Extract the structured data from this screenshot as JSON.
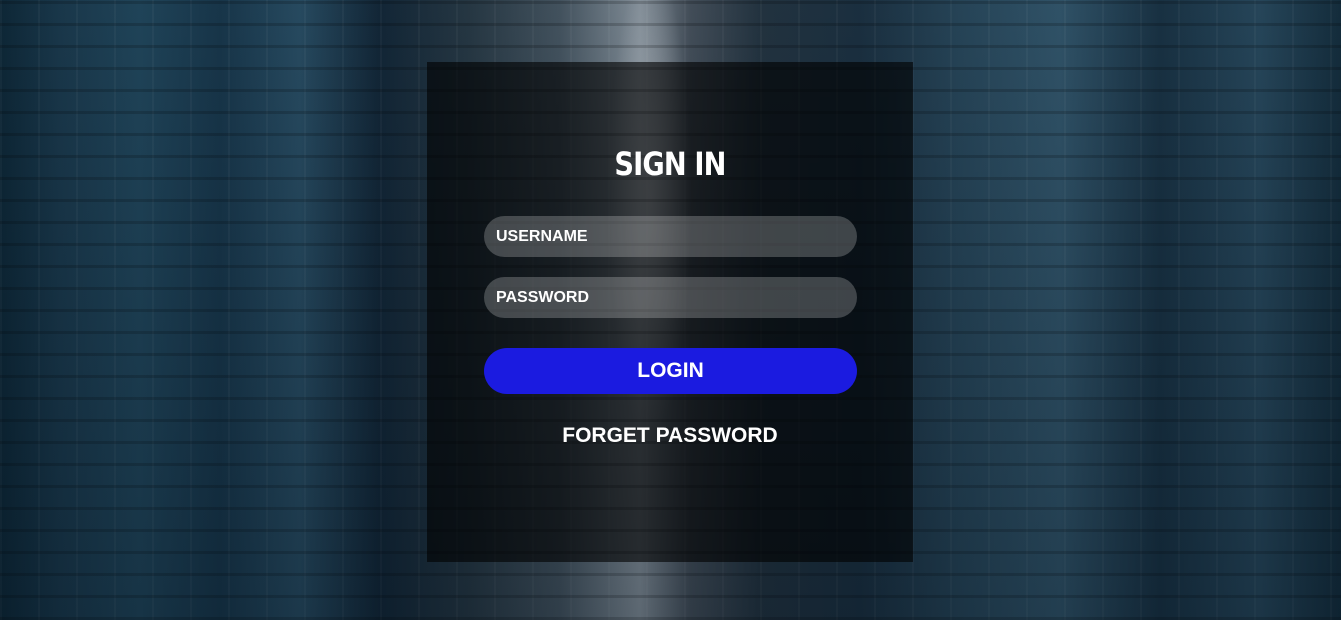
{
  "login": {
    "title": "SIGN IN",
    "username_placeholder": "USERNAME",
    "password_placeholder": "PASSWORD",
    "login_label": "LOGIN",
    "forget_label": "FORGET PASSWORD"
  },
  "colors": {
    "panel_overlay": "rgba(0,0,0,0.6)",
    "field_background": "rgba(255,255,255,0.22)",
    "login_button": "#1b1be0",
    "text": "#ffffff"
  }
}
